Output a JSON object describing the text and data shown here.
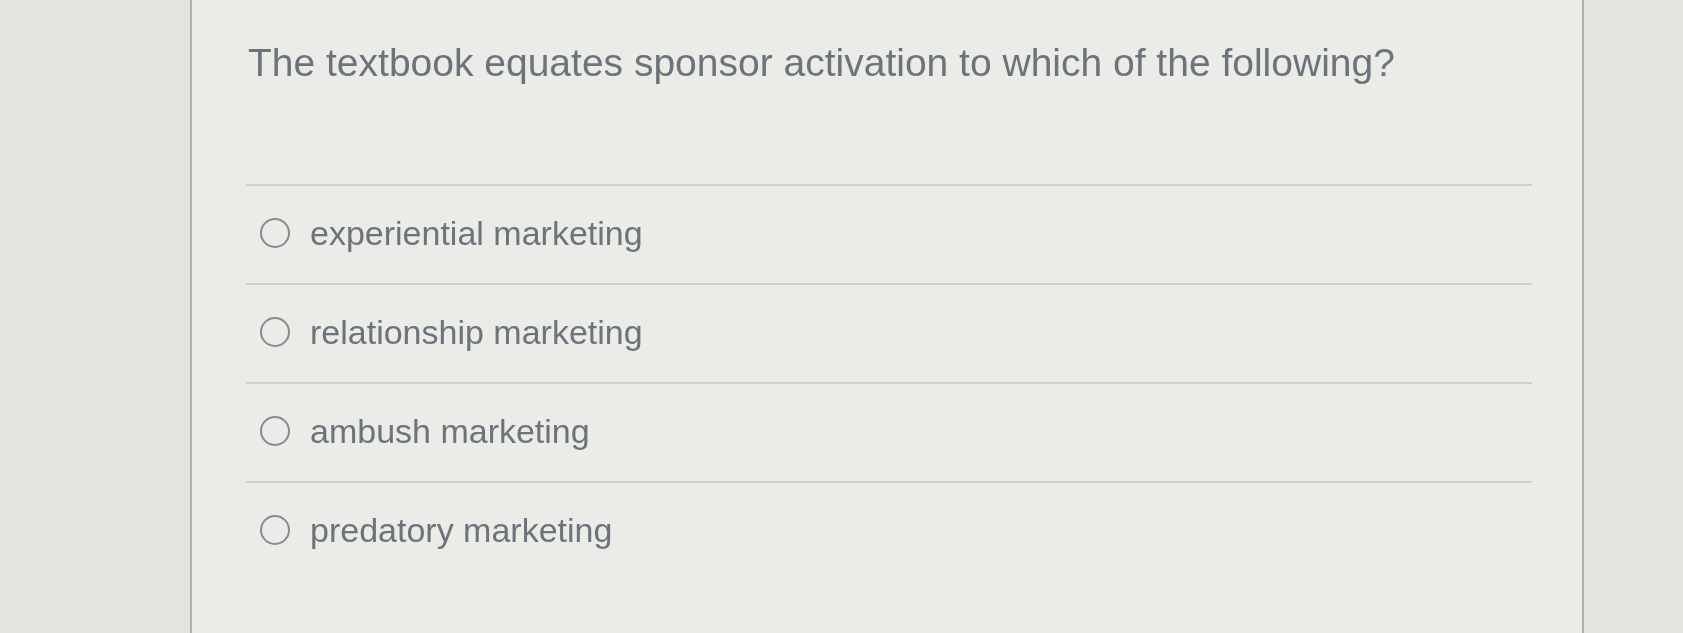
{
  "question": "The textbook equates sponsor activation to which of the following?",
  "options": [
    {
      "label": "experiential marketing",
      "selected": false
    },
    {
      "label": "relationship marketing",
      "selected": false
    },
    {
      "label": "ambush marketing",
      "selected": false
    },
    {
      "label": "predatory marketing",
      "selected": false
    }
  ]
}
